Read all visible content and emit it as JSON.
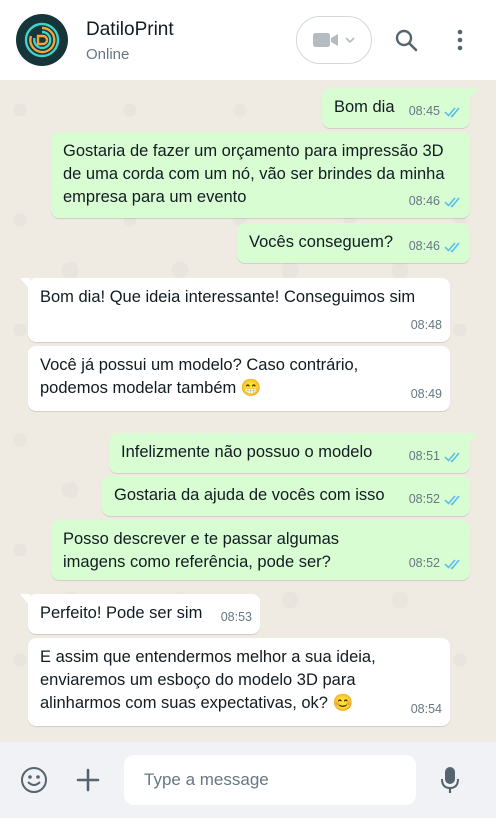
{
  "header": {
    "contact_name": "DatiloPrint",
    "status": "Online",
    "avatar_icon": "fingerprint-logo-icon",
    "video_icon": "video-camera-icon",
    "search_icon": "search-icon",
    "menu_icon": "more-vertical-icon"
  },
  "messages": [
    {
      "direction": "out",
      "text": "Bom dia",
      "time": "08:45",
      "status": "read"
    },
    {
      "direction": "out",
      "text": "Gostaria de fazer um orçamento para impressão 3D de uma corda com um nó, vão ser brindes da minha empresa para um evento",
      "time": "08:46",
      "status": "read"
    },
    {
      "direction": "out",
      "text": "Vocês conseguem?",
      "time": "08:46",
      "status": "read"
    },
    {
      "direction": "in",
      "text": "Bom dia! Que ideia interessante! Conseguimos sim",
      "time": "08:48"
    },
    {
      "direction": "in",
      "text": "Você já possui um modelo? Caso contrário, podemos modelar também 😁",
      "time": "08:49"
    },
    {
      "direction": "out",
      "text": "Infelizmente não possuo o modelo",
      "time": "08:51",
      "status": "read"
    },
    {
      "direction": "out",
      "text": "Gostaria da ajuda de vocês com isso",
      "time": "08:52",
      "status": "read"
    },
    {
      "direction": "out",
      "text": "Posso descrever e te passar algumas imagens como referência, pode ser?",
      "time": "08:52",
      "status": "read"
    },
    {
      "direction": "in",
      "text": "Perfeito! Pode ser sim",
      "time": "08:53"
    },
    {
      "direction": "in",
      "text": "E assim que entendermos melhor a sua ideia, enviaremos um esboço do modelo 3D para alinharmos com suas expectativas, ok? 😊",
      "time": "08:54"
    }
  ],
  "footer": {
    "emoji_icon": "emoji-icon",
    "attach_icon": "plus-icon",
    "input_placeholder": "Type a message",
    "input_value": "",
    "mic_icon": "microphone-icon"
  },
  "colors": {
    "outgoing_bubble": "#d9fdd3",
    "incoming_bubble": "#ffffff",
    "read_ticks": "#53bdeb",
    "chat_background": "#efeae2"
  }
}
